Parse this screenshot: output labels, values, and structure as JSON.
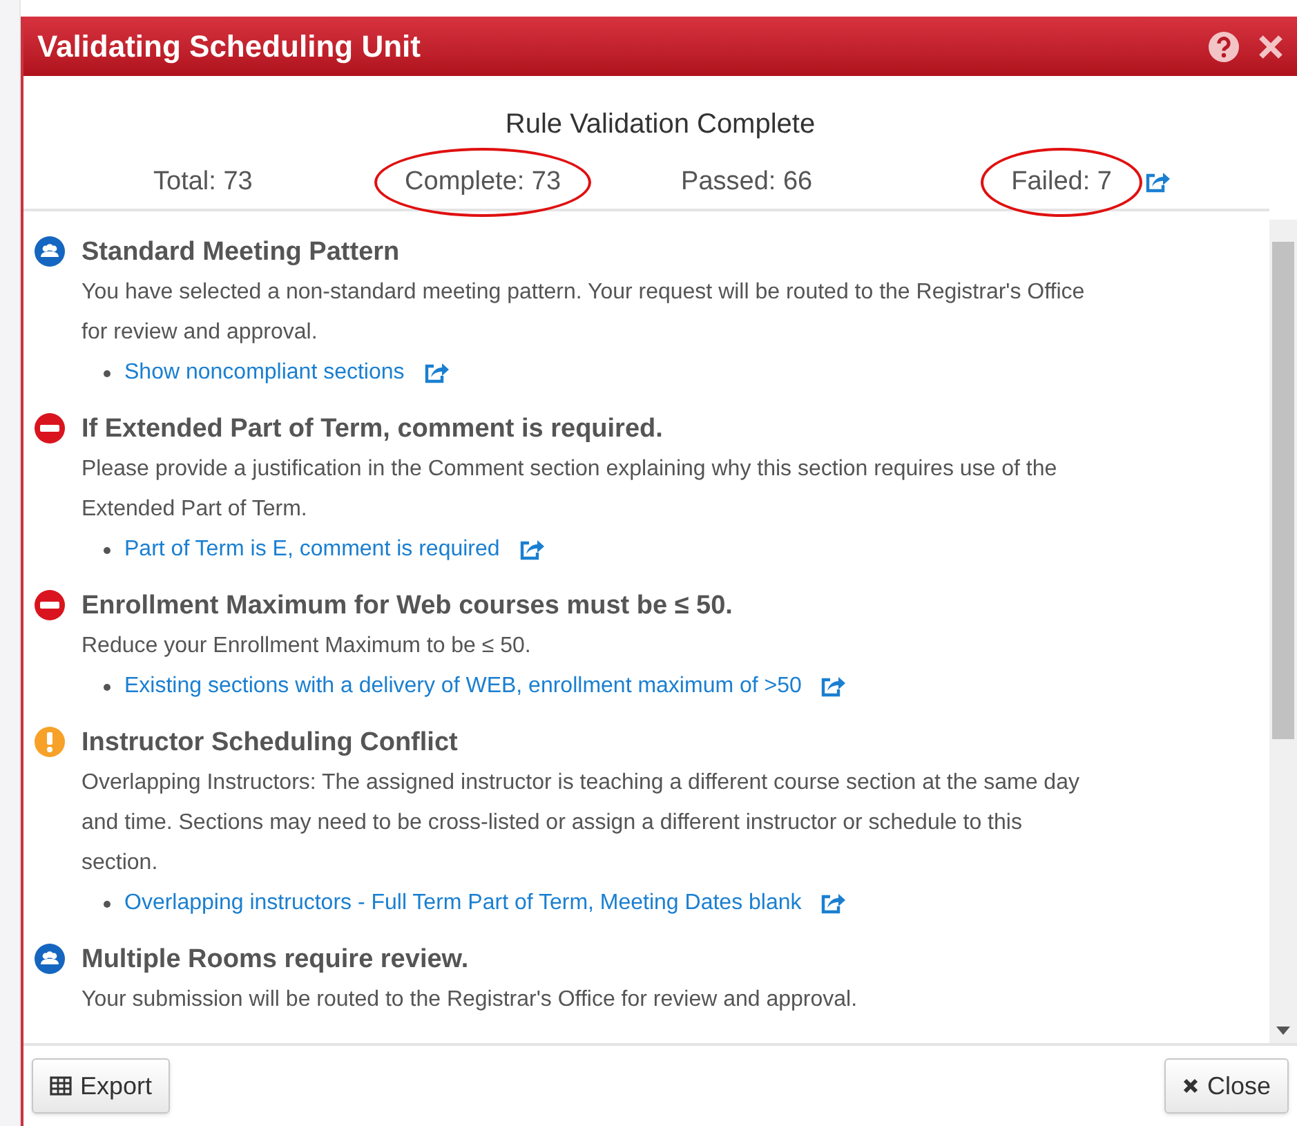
{
  "dialog": {
    "title": "Validating Scheduling Unit",
    "heading": "Rule Validation Complete"
  },
  "stats": [
    {
      "label": "Total: 73",
      "circled": false
    },
    {
      "label": "Complete: 73",
      "circled": true
    },
    {
      "label": "Passed: 66",
      "circled": false
    },
    {
      "label": "Failed: 7",
      "circled": true
    }
  ],
  "rules": [
    {
      "kind": "info",
      "title": "Standard Meeting Pattern",
      "description": "You have selected a non-standard meeting pattern. Your request will be routed to the Registrar's Office for review and approval.",
      "link": "Show noncompliant sections"
    },
    {
      "kind": "error",
      "title": "If Extended Part of Term, comment is required.",
      "description": "Please provide a justification in the Comment section explaining why this section requires use of the Extended Part of Term.",
      "link": "Part of Term is E, comment is required"
    },
    {
      "kind": "error",
      "title": "Enrollment Maximum for Web courses must be ≤ 50.",
      "description": "Reduce your Enrollment Maximum to be ≤ 50.",
      "link": "Existing sections with a delivery of WEB, enrollment maximum of >50"
    },
    {
      "kind": "warning",
      "title": "Instructor Scheduling Conflict",
      "description": "Overlapping Instructors: The assigned instructor is teaching a different course section at the same day and time. Sections may need to be cross-listed or assign a different instructor or schedule to this section.",
      "link": "Overlapping instructors - Full Term Part of Term, Meeting Dates blank"
    },
    {
      "kind": "info",
      "title": "Multiple Rooms require review.",
      "description": "Your submission will be routed to the Registrar's Office for review and approval."
    }
  ],
  "buttons": [
    {
      "kind": "export",
      "label": "Export"
    },
    {
      "kind": "close",
      "label": "Close"
    }
  ]
}
